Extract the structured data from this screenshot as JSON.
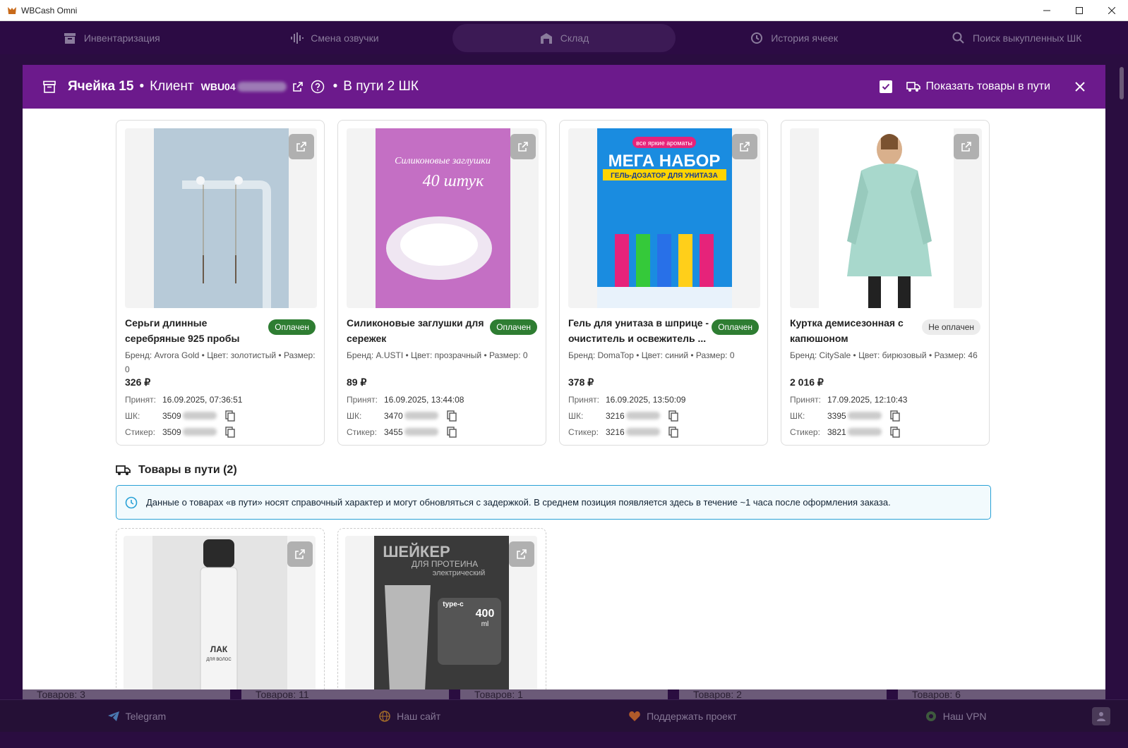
{
  "window": {
    "title": "WBCash Omni"
  },
  "nav": {
    "items": [
      {
        "label": "Инвентаризация",
        "icon": "archive-icon"
      },
      {
        "label": "Смена озвучки",
        "icon": "waveform-icon"
      },
      {
        "label": "Склад",
        "icon": "warehouse-icon",
        "active": true
      },
      {
        "label": "История ячеек",
        "icon": "history-icon"
      },
      {
        "label": "Поиск выкупленных ШК",
        "icon": "search-icon"
      }
    ]
  },
  "modal": {
    "cell_title": "Ячейка 15",
    "client_label": "Клиент",
    "client_code": "WBU04",
    "in_transit_title": "В пути 2 ШК",
    "show_transit_label": "Показать товары в пути",
    "show_transit_checked": true
  },
  "products": [
    {
      "name": "Серьги длинные серебряные 925 пробы",
      "status": "Оплачен",
      "paid": true,
      "meta": "Бренд: Avrora Gold • Цвет: золотистый • Размер: 0",
      "price": "326 ₽",
      "accepted_label": "Принят:",
      "accepted": "16.09.2025, 07:36:51",
      "barcode_label": "ШК:",
      "barcode": "3509",
      "sticker_label": "Стикер:",
      "sticker": "3509"
    },
    {
      "name": "Силиконовые заглушки для сережек",
      "status": "Оплачен",
      "paid": true,
      "meta": "Бренд: A.USTI • Цвет: прозрачный • Размер: 0",
      "price": "89 ₽",
      "accepted_label": "Принят:",
      "accepted": "16.09.2025, 13:44:08",
      "barcode_label": "ШК:",
      "barcode": "3470",
      "sticker_label": "Стикер:",
      "sticker": "3455",
      "image_text_1": "Силиконовые заглушки",
      "image_text_2": "40 штук"
    },
    {
      "name": "Гель для унитаза в шприце - очиститель и освежитель ...",
      "status": "Оплачен",
      "paid": true,
      "meta": "Бренд: DomaTop • Цвет: синий • Размер: 0",
      "price": "378 ₽",
      "accepted_label": "Принят:",
      "accepted": "16.09.2025, 13:50:09",
      "barcode_label": "ШК:",
      "barcode": "3216",
      "sticker_label": "Стикер:",
      "sticker": "3216",
      "image_text_1": "все яркие ароматы",
      "image_text_2": "МЕГА НАБОР",
      "image_text_3": "ГЕЛЬ-ДОЗАТОР ДЛЯ УНИТАЗА"
    },
    {
      "name": "Куртка демисезонная с капюшоном",
      "status": "Не оплачен",
      "paid": false,
      "meta": "Бренд: CitySale • Цвет: бирюзовый • Размер: 46",
      "price": "2 016 ₽",
      "accepted_label": "Принят:",
      "accepted": "17.09.2025, 12:10:43",
      "barcode_label": "ШК:",
      "barcode": "3395",
      "sticker_label": "Стикер:",
      "sticker": "3821"
    }
  ],
  "transit": {
    "title": "Товары в пути (2)",
    "info": "Данные о товарах «в пути» носят справочный характер и могут обновляться с задержкой. В среднем позиция появляется здесь в течение ~1 часа после оформления заказа.",
    "items": [
      {
        "image_text_1": "ЛАК",
        "image_text_2": "ДЛЯ ВОЛОС"
      },
      {
        "image_text_1": "ШЕЙКЕР",
        "image_text_2": "ДЛЯ ПРОТЕИНА",
        "image_text_3": "электрический",
        "image_text_4": "type-c",
        "image_text_5": "400",
        "image_text_6": "ml"
      }
    ]
  },
  "background_counts": [
    "Товаров: 3",
    "Товаров: 11",
    "Товаров: 1",
    "Товаров: 2",
    "Товаров: 6"
  ],
  "footer": {
    "items": [
      {
        "label": "Telegram",
        "icon": "telegram-icon"
      },
      {
        "label": "Наш сайт",
        "icon": "globe-icon"
      },
      {
        "label": "Поддержать проект",
        "icon": "heart-icon"
      },
      {
        "label": "Наш VPN",
        "icon": "vpn-icon"
      }
    ]
  }
}
